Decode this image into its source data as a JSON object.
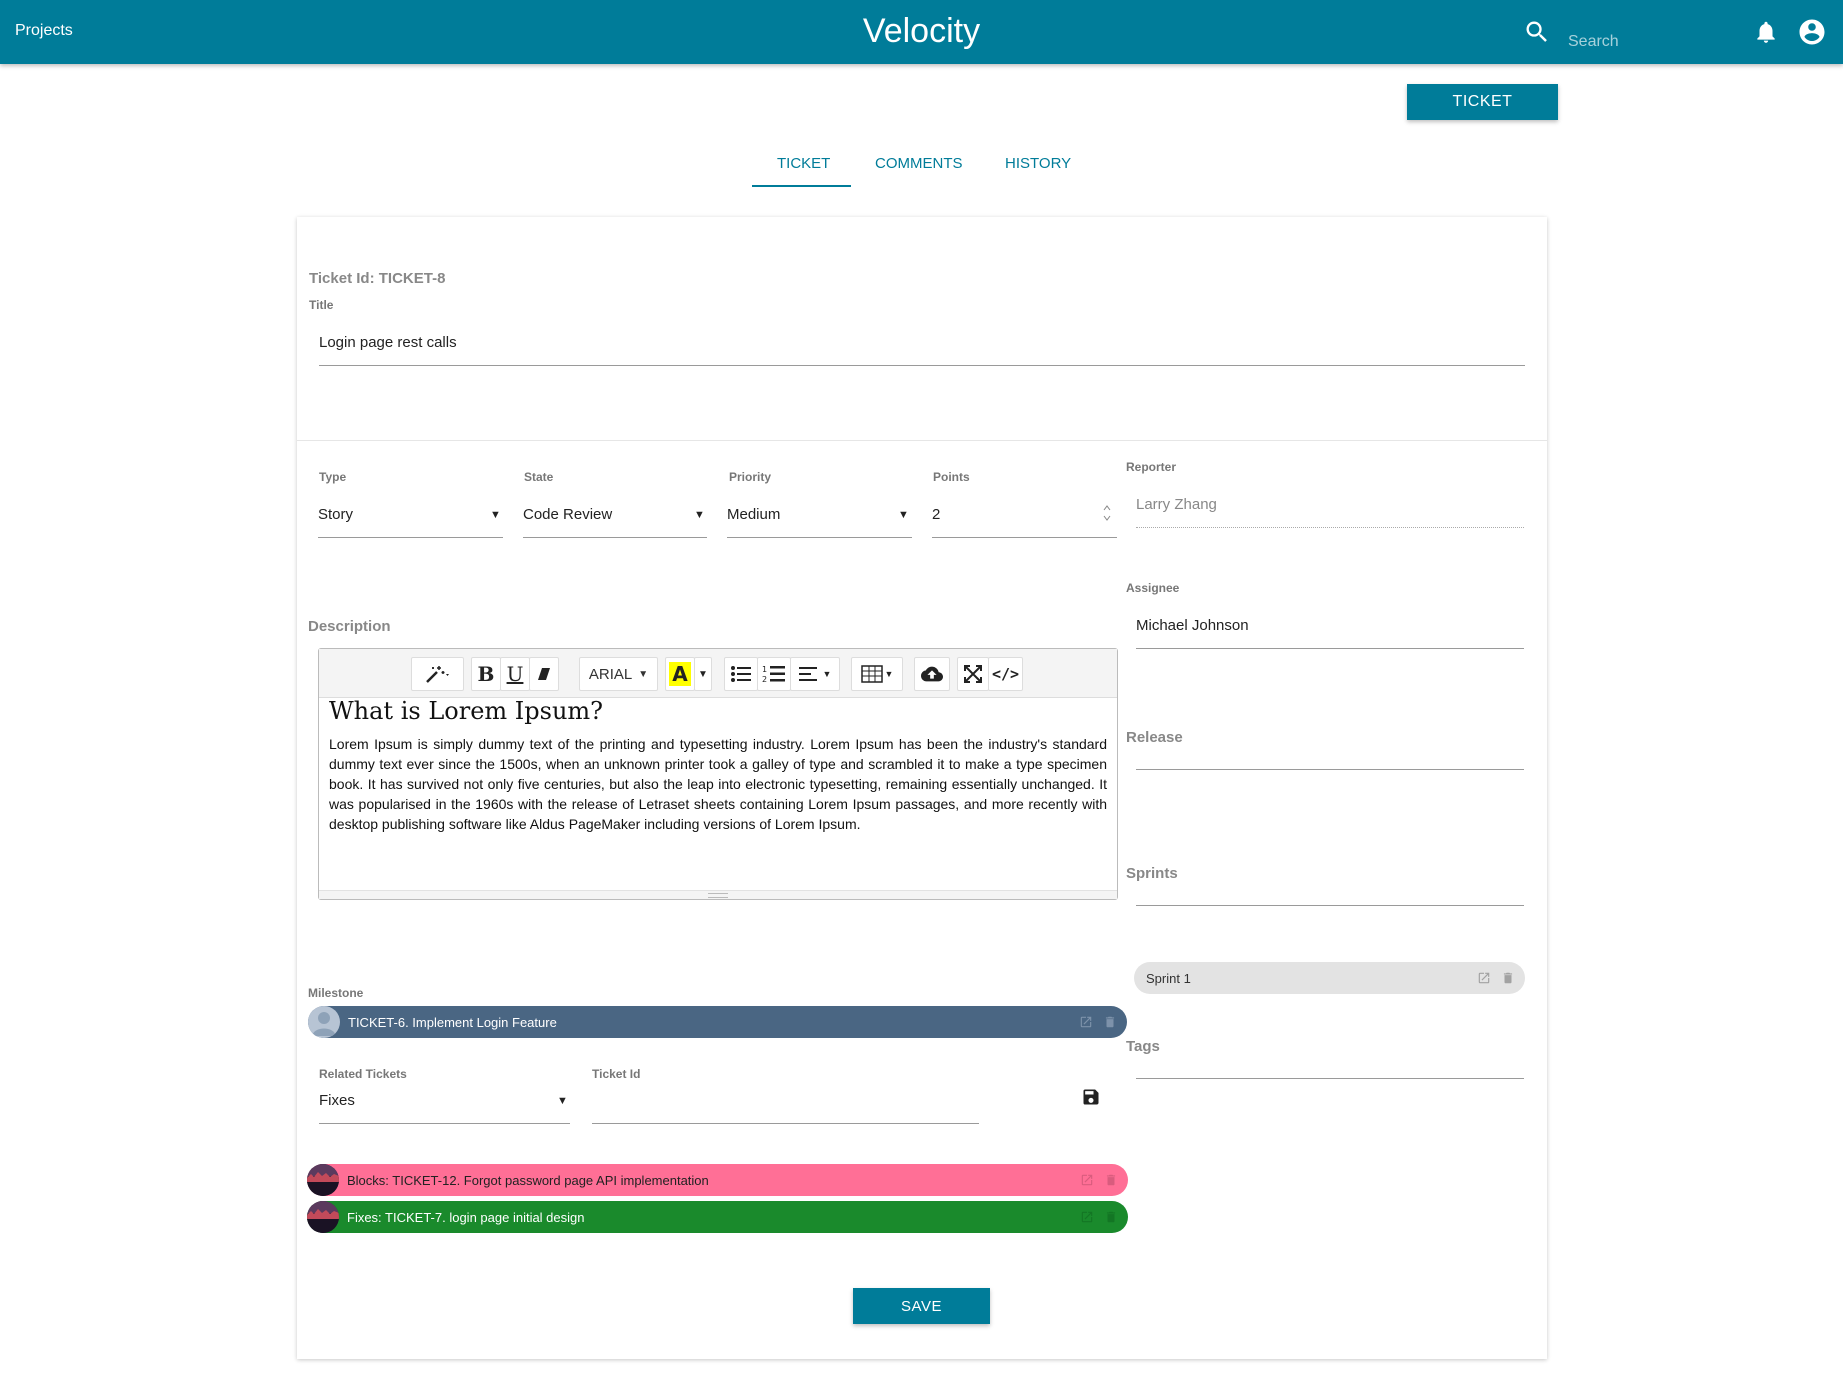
{
  "header": {
    "projects_label": "Projects",
    "app_title": "Velocity",
    "search_placeholder": "Search",
    "icons": [
      "search-icon",
      "bell-icon",
      "account-circle-icon"
    ],
    "bar_color": "#007c99"
  },
  "top_button": {
    "label": "TICKET"
  },
  "tabs": [
    {
      "label": "TICKET",
      "active": true
    },
    {
      "label": "COMMENTS",
      "active": false
    },
    {
      "label": "HISTORY",
      "active": false
    }
  ],
  "ticket": {
    "id_label": "Ticket Id: TICKET-8",
    "title_label": "Title",
    "title_value": "Login page rest calls",
    "type": {
      "label": "Type",
      "value": "Story"
    },
    "state": {
      "label": "State",
      "value": "Code Review"
    },
    "priority": {
      "label": "Priority",
      "value": "Medium"
    },
    "points": {
      "label": "Points",
      "value": "2"
    },
    "reporter": {
      "label": "Reporter",
      "value": "Larry Zhang"
    },
    "assignee": {
      "label": "Assignee",
      "value": "Michael Johnson"
    },
    "release": {
      "label": "Release",
      "value": ""
    },
    "sprints": {
      "label": "Sprints",
      "chips": [
        {
          "label": "Sprint 1"
        }
      ]
    },
    "tags": {
      "label": "Tags",
      "value": ""
    }
  },
  "description": {
    "label": "Description",
    "toolbar": {
      "font_label": "ARIAL",
      "icons": [
        "magic-style-icon",
        "bold-icon",
        "underline-icon",
        "eraser-icon",
        "font-name-dropdown",
        "highlight-color-icon",
        "bullet-list-icon",
        "numbered-list-icon",
        "align-icon",
        "table-icon",
        "cloud-upload-icon",
        "fullscreen-icon",
        "code-view-icon"
      ]
    },
    "heading": "What is Lorem Ipsum?",
    "body": "Lorem Ipsum is simply dummy text of the printing and typesetting industry. Lorem Ipsum has been the industry's standard dummy text ever since the 1500s, when an unknown printer took a galley of type and scrambled it to make a type specimen book. It has survived not only five centuries, but also the leap into electronic typesetting, remaining essentially unchanged. It was popularised in the 1960s with the release of Letraset sheets containing Lorem Ipsum passages, and more recently with desktop publishing software like Aldus PageMaker including versions of Lorem Ipsum."
  },
  "milestone": {
    "label": "Milestone",
    "chip": {
      "label": "TICKET-6. Implement Login Feature",
      "color": "#4a6683"
    }
  },
  "related": {
    "label": "Related Tickets",
    "value": "Fixes",
    "ticket_id_label": "Ticket Id",
    "ticket_id_value": "",
    "chips": [
      {
        "label": "Blocks: TICKET-12. Forgot password page API implementation",
        "color": "#ff6f96"
      },
      {
        "label": "Fixes: TICKET-7. login page initial design",
        "color": "#1a8a2c"
      }
    ]
  },
  "save_label": "SAVE"
}
